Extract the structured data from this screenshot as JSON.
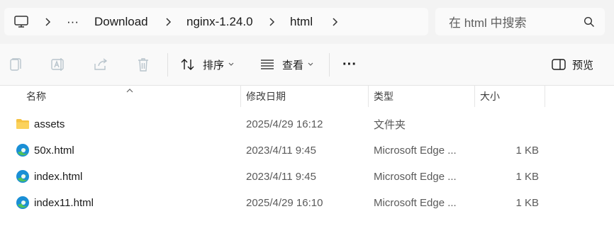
{
  "breadcrumb": {
    "overflow": "···",
    "items": [
      "Download",
      "nginx-1.24.0",
      "html"
    ]
  },
  "search": {
    "placeholder": "在 html 中搜索"
  },
  "toolbar": {
    "sort_label": "排序",
    "view_label": "查看",
    "more_label": "···",
    "preview_label": "预览"
  },
  "columns": {
    "name": "名称",
    "date": "修改日期",
    "type": "类型",
    "size": "大小"
  },
  "files": [
    {
      "name": "assets",
      "date": "2025/4/29 16:12",
      "type": "文件夹",
      "size": "",
      "icon": "folder-icon"
    },
    {
      "name": "50x.html",
      "date": "2023/4/11 9:45",
      "type": "Microsoft Edge ...",
      "size": "1 KB",
      "icon": "edge-icon"
    },
    {
      "name": "index.html",
      "date": "2023/4/11 9:45",
      "type": "Microsoft Edge ...",
      "size": "1 KB",
      "icon": "edge-icon"
    },
    {
      "name": "index11.html",
      "date": "2025/4/29 16:10",
      "type": "Microsoft Edge ...",
      "size": "1 KB",
      "icon": "edge-icon"
    }
  ],
  "colors": {
    "folder": "#f5c242",
    "edge_blue": "#1a8fd6",
    "edge_green": "#4fc25a"
  }
}
